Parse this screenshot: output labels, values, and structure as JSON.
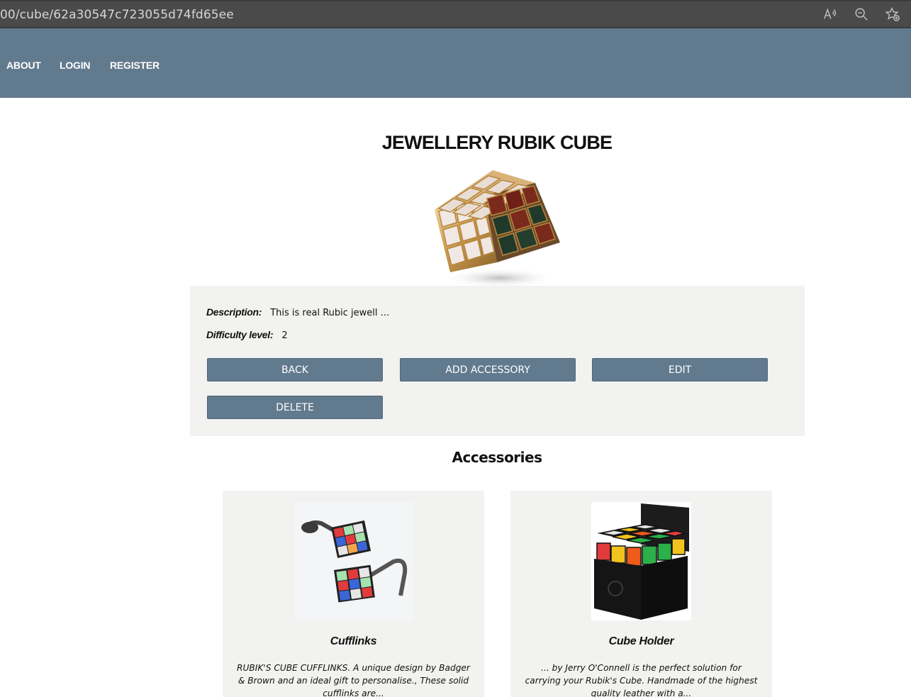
{
  "browser": {
    "url": "00/cube/62a30547c723055d74fd65ee",
    "icons": [
      "read-aloud-icon",
      "zoom-out-icon",
      "add-favorite-icon"
    ]
  },
  "nav": {
    "about": "ABOUT",
    "login": "LOGIN",
    "register": "REGISTER"
  },
  "cube": {
    "title": "JEWELLERY RUBIK CUBE",
    "description_label": "Description:",
    "description": "This is real Rubic jewell ...",
    "difficulty_label": "Difficulty level:",
    "difficulty": "2"
  },
  "actions": {
    "back": "BACK",
    "add_accessory": "ADD ACCESSORY",
    "edit": "EDIT",
    "delete": "DELETE"
  },
  "accessories": {
    "heading": "Accessories",
    "items": [
      {
        "name": "Cufflinks",
        "description": "RUBIK'S CUBE CUFFLINKS. A unique design by Badger & Brown and an ideal gift to personalise., These solid cufflinks are..."
      },
      {
        "name": "Cube Holder",
        "description": "... by Jerry O'Connell is the perfect solution for carrying your Rubik's Cube. Handmade of the highest quality leather with a..."
      }
    ]
  },
  "colors": {
    "navbar": "#627a8e",
    "button": "#627a8e",
    "panel": "#f2f2f0"
  }
}
